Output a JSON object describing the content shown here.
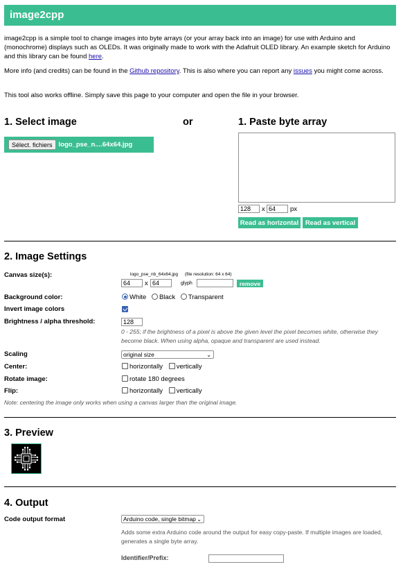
{
  "header": {
    "title": "image2cpp"
  },
  "intro": {
    "p1_text": "image2cpp is a simple tool to change images into byte arrays (or your array back into an image) for use with Arduino and (monochrome) displays such as OLEDs. It was originally made to work with the Adafruit OLED library. An example sketch for Arduino and this library can be found ",
    "p1_link": "here",
    "p1_end": ".",
    "p2_text": "More info (and credits) can be found in the ",
    "p2_link1": "Github repository",
    "p2_mid": ". This is also where you can report any ",
    "p2_link2": "issues",
    "p2_end": " you might come across.",
    "p3_text": "This tool also works offline. Simply save this page to your computer and open the file in your browser."
  },
  "select_image": {
    "heading": "1. Select image",
    "file_button": "Sélect. fichiers",
    "file_name": "logo_pse_n....64x64.jpg"
  },
  "or_label": "or",
  "paste_array": {
    "heading": "1. Paste byte array",
    "textarea_value": "",
    "width_value": "128",
    "height_value": "64",
    "x_label": "x",
    "px_label": "px",
    "read_horizontal": "Read as horizontal",
    "read_vertical": "Read as vertical"
  },
  "image_settings": {
    "heading": "2. Image Settings",
    "canvas_label": "Canvas size(s):",
    "canvas_file_name": "logo_pse_nb_64x64.jpg",
    "canvas_file_res": "(file resolution: 64 x 64)",
    "canvas_w": "64",
    "canvas_h": "64",
    "canvas_x": "x",
    "glyph_label": "glyph",
    "glyph_value": "",
    "remove_button": "remove",
    "bg_label": "Background color:",
    "bg_options": [
      "White",
      "Black",
      "Transparent"
    ],
    "bg_selected": "White",
    "invert_label": "Invert image colors",
    "invert_checked": true,
    "brightness_label": "Brightness / alpha threshold:",
    "brightness_value": "128",
    "brightness_note": "0 - 255; if the brightness of a pixel is above the given level the pixel becomes white, otherwise they become black. When using alpha, opaque and transparent are used instead.",
    "scaling_label": "Scaling",
    "scaling_value": "original size",
    "center_label": "Center:",
    "center_h": "horizontally",
    "center_v": "vertically",
    "rotate_label": "Rotate image:",
    "rotate_option": "rotate 180 degrees",
    "flip_label": "Flip:",
    "flip_h": "horizontally",
    "flip_v": "vertically",
    "note": "Note: centering the image only works when using a canvas larger than the original image."
  },
  "preview": {
    "heading": "3. Preview"
  },
  "output": {
    "heading": "4. Output",
    "format_label": "Code output format",
    "format_value": "Arduino code, single bitmap",
    "format_note": "Adds some extra Arduino code around the output for easy copy-paste. If multiple images are loaded, generates a single byte array.",
    "identifier_label": "Identifier/Prefix:",
    "identifier_value": ""
  },
  "colors": {
    "accent": "#3bbd92",
    "link": "#1a0dab",
    "checkbox": "#3b63b5"
  },
  "icons": {
    "preview_image": "circuit-chip-icon",
    "dropdown": "chevron-down-icon"
  }
}
